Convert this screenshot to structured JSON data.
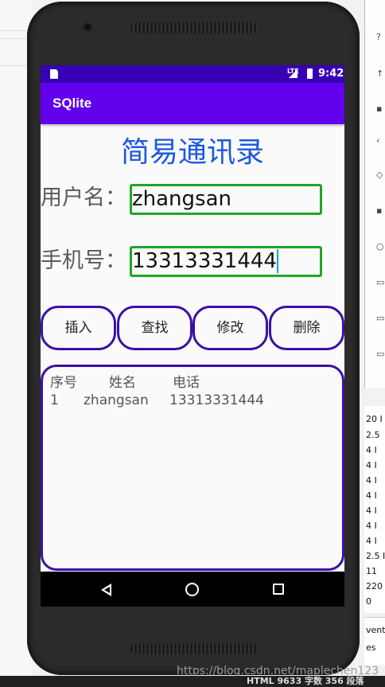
{
  "app": {
    "title": "SQlite",
    "status_time": "9:42",
    "status_network": "LTE"
  },
  "heading": "简易通讯录",
  "form": {
    "username_label": "用户名：",
    "username_value": "zhangsan",
    "phone_label": "手机号：",
    "phone_value": "13313331444"
  },
  "buttons": {
    "insert": "插入",
    "query": "查找",
    "update": "修改",
    "delete": "删除"
  },
  "result": {
    "headers": [
      "序号",
      "姓名",
      "电话"
    ],
    "rows": [
      [
        "1",
        "zhangsan",
        "13313331444"
      ]
    ]
  },
  "background": {
    "watermark": "https://blog.csdn.net/maplechen123",
    "bottom_status": "HTML  9633 字数  356 段落",
    "right_numbers": [
      "20 I",
      "2.5",
      "4 I",
      "4 I",
      "4 I",
      "4 I",
      "4 I",
      "4 I",
      "4 I",
      "2.5 I",
      "11",
      "220",
      "0"
    ],
    "right_labels": [
      "vent",
      "es"
    ]
  },
  "colors": {
    "status_bar": "#3700b3",
    "app_bar": "#6200ee",
    "heading": "#1f58e0",
    "field_border": "#1fa52a",
    "button_border": "#3a10a8"
  }
}
